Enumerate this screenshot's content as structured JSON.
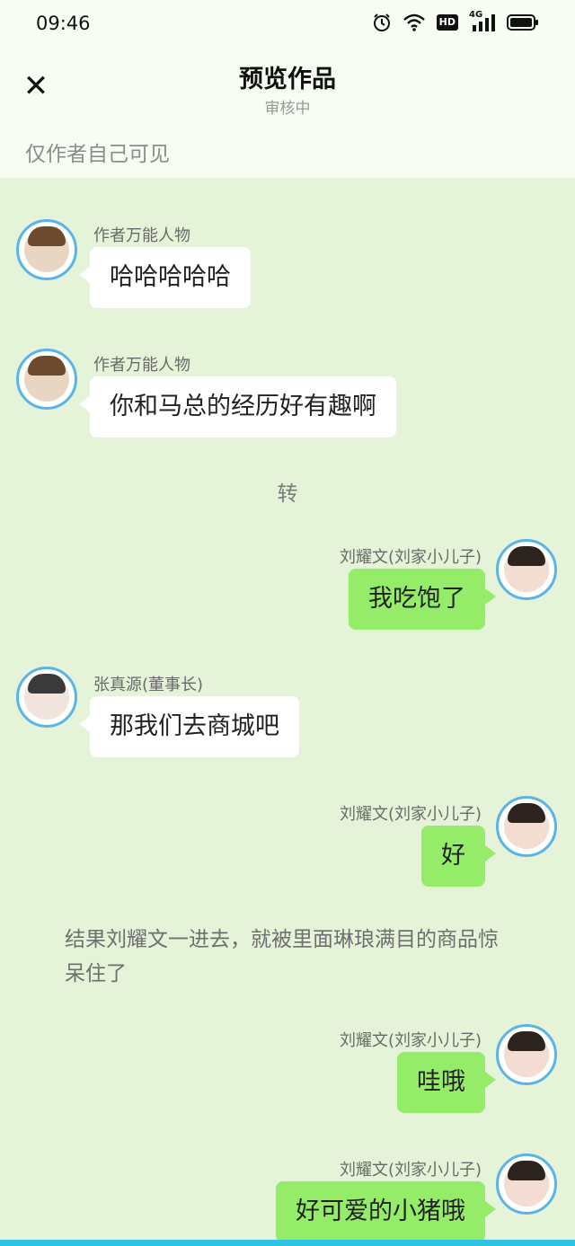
{
  "status": {
    "time": "09:46",
    "hd": "HD",
    "net": "4G",
    "icons": [
      "alarm-icon",
      "wifi-icon",
      "hd-icon",
      "signal-icon",
      "battery-icon"
    ]
  },
  "header": {
    "title": "预览作品",
    "subtitle": "审核中",
    "close_icon": "close-icon"
  },
  "visibility_note": "仅作者自己可见",
  "messages": [
    {
      "side": "left",
      "name": "作者万能人物",
      "text": "哈哈哈哈哈"
    },
    {
      "side": "left",
      "name": "作者万能人物",
      "text": "你和马总的经历好有趣啊"
    },
    {
      "side": "center",
      "text": "转"
    },
    {
      "side": "right",
      "name": "刘耀文(刘家小儿子)",
      "text": "我吃饱了"
    },
    {
      "side": "left",
      "name": "张真源(董事长)",
      "text": "那我们去商城吧"
    },
    {
      "side": "right",
      "name": "刘耀文(刘家小儿子)",
      "text": "好"
    },
    {
      "side": "narration",
      "text": "结果刘耀文一进去，就被里面琳琅满目的商品惊呆住了"
    },
    {
      "side": "right",
      "name": "刘耀文(刘家小儿子)",
      "text": "哇哦"
    },
    {
      "side": "right",
      "name": "刘耀文(刘家小儿子)",
      "text": "好可爱的小猪哦"
    }
  ],
  "colors": {
    "page_bg": "#e5f3d9",
    "header_bg": "#f7fdf2",
    "bubble_right": "#95ec69",
    "bubble_left": "#ffffff",
    "avatar_ring": "#5ab4e8",
    "bottom_bar": "#31c3e6"
  }
}
